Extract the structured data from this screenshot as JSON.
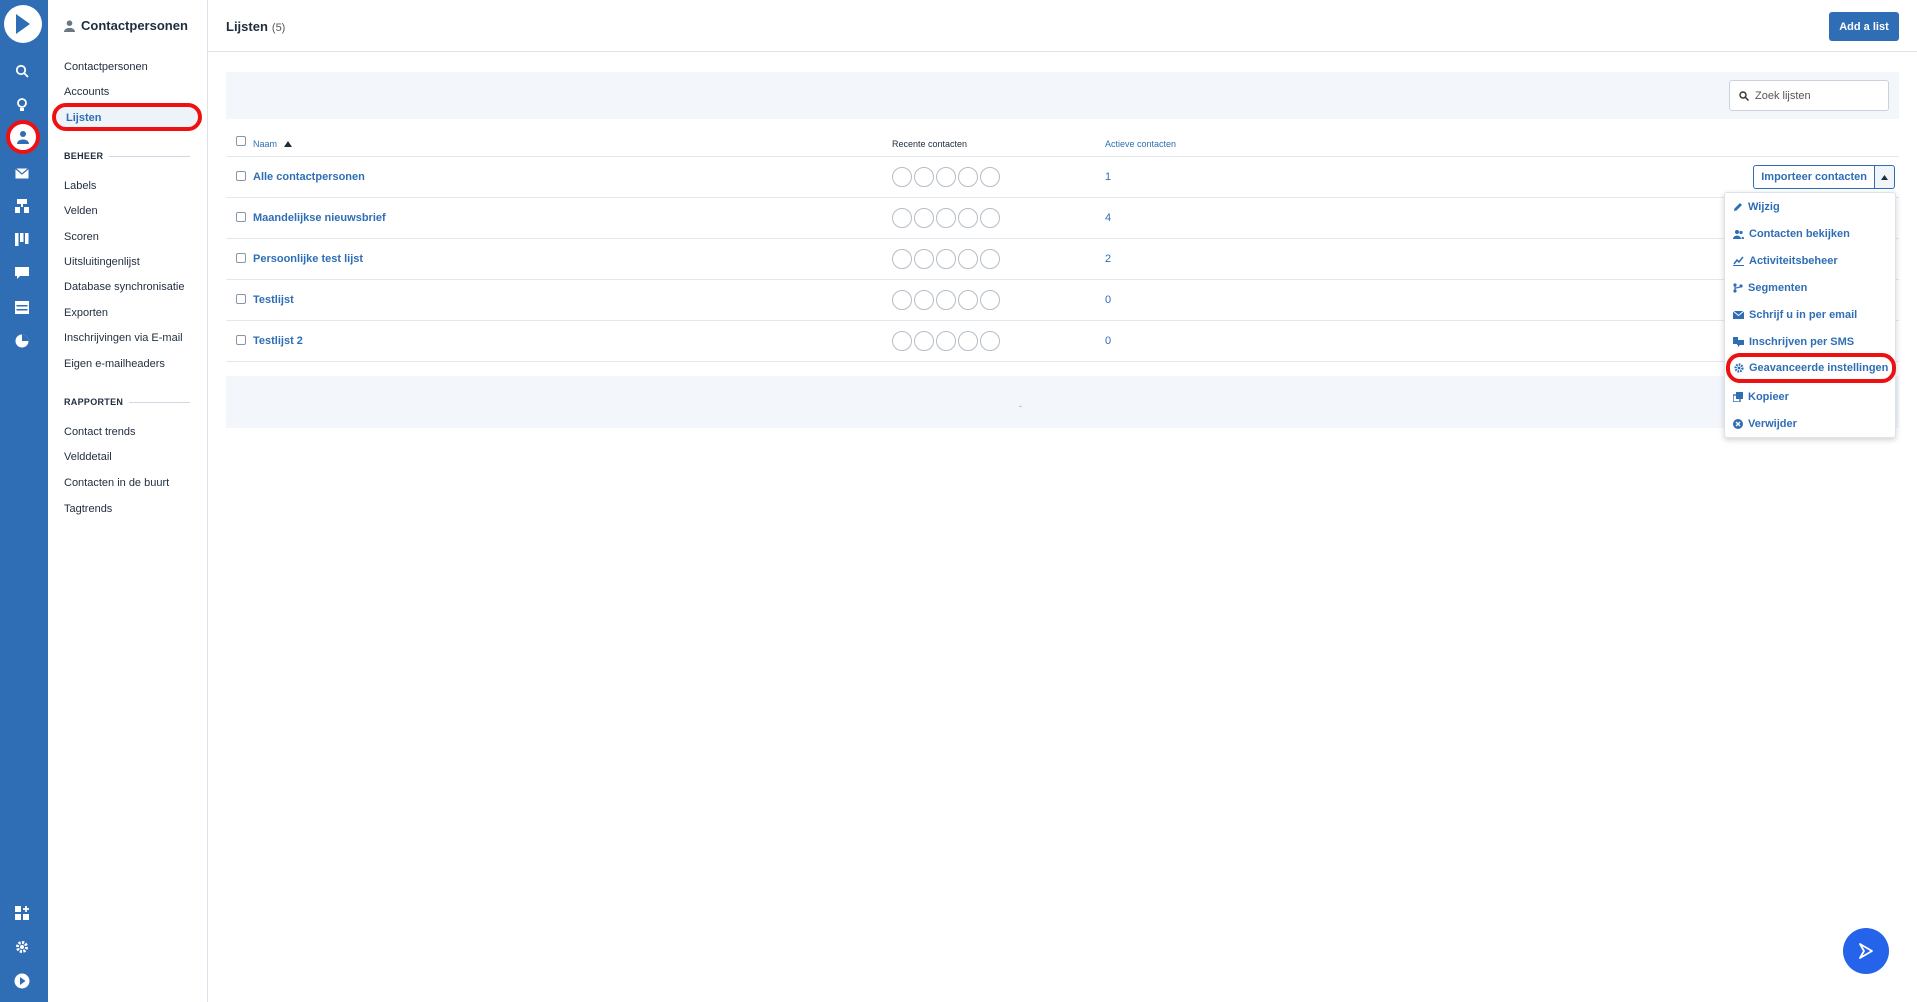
{
  "sidebar": {
    "title": "Contactpersonen",
    "items": [
      "Contactpersonen",
      "Accounts",
      "Lijsten"
    ],
    "beheer_heading": "BEHEER",
    "beheer": [
      "Labels",
      "Velden",
      "Scoren",
      "Uitsluitingenlijst",
      "Database synchronisatie",
      "Exporten",
      "Inschrijvingen via E-mail",
      "Eigen e-mailheaders"
    ],
    "rapporten_heading": "RAPPORTEN",
    "rapporten": [
      "Contact trends",
      "Velddetail",
      "Contacten in de buurt",
      "Tagtrends"
    ]
  },
  "header": {
    "title": "Lijsten",
    "count": "(5)",
    "add_button": "Add a list"
  },
  "search": {
    "placeholder": "Zoek lijsten"
  },
  "table": {
    "columns": {
      "name": "Naam",
      "recent": "Recente contacten",
      "active": "Actieve contacten"
    },
    "rows": [
      {
        "name": "Alle contactpersonen",
        "active": "1"
      },
      {
        "name": "Maandelijkse nieuwsbrief",
        "active": "4"
      },
      {
        "name": "Persoonlijke test lijst",
        "active": "2"
      },
      {
        "name": "Testlijst",
        "active": "0"
      },
      {
        "name": "Testlijst 2",
        "active": "0"
      }
    ],
    "import_button": "Importeer contacten",
    "footer_text": "-"
  },
  "menu": {
    "items": [
      "Wijzig",
      "Contacten bekijken",
      "Activiteitsbeheer",
      "Segmenten",
      "Schrijf u in per email",
      "Inschrijven per SMS",
      "Geavanceerde instellingen",
      "Kopieer",
      "Verwijder"
    ]
  },
  "colors": {
    "accent": "#2f6eb5",
    "highlight": "#e11111",
    "fab": "#2563eb"
  }
}
